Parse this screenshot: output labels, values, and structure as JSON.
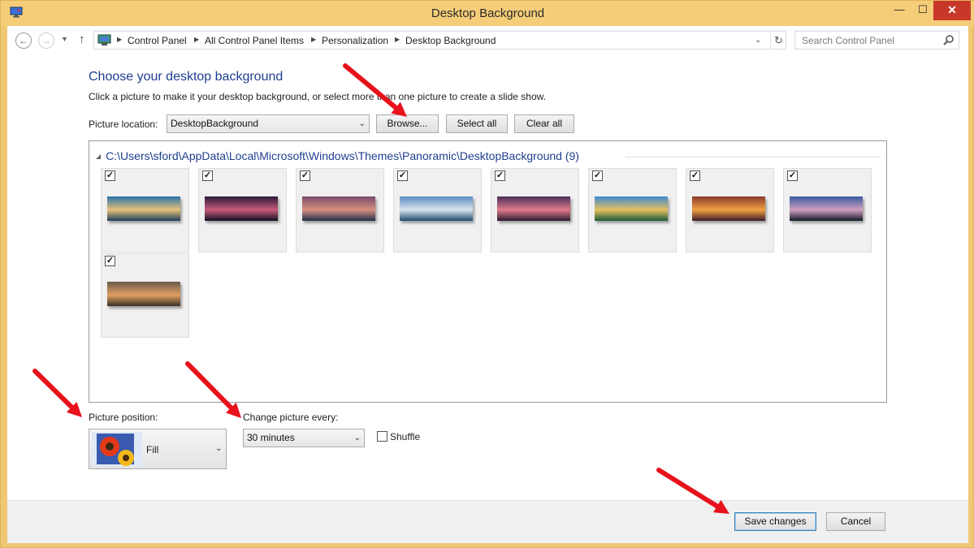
{
  "window": {
    "title": "Desktop Background",
    "min_glyph": "—",
    "max_glyph": "☐",
    "close_glyph": "✕"
  },
  "nav": {
    "back_glyph": "←",
    "forward_glyph": "→",
    "up_glyph": "↑",
    "breadcrumbs": [
      "Control Panel",
      "All Control Panel Items",
      "Personalization",
      "Desktop Background"
    ],
    "search_placeholder": "Search Control Panel"
  },
  "main": {
    "heading": "Choose your desktop background",
    "subtext": "Click a picture to make it your desktop background, or select more than one picture to create a slide show.",
    "picture_location_label": "Picture location:",
    "picture_location_value": "DesktopBackground",
    "browse_label": "Browse...",
    "select_all_label": "Select all",
    "clear_all_label": "Clear all",
    "group_path": "C:\\Users\\sford\\AppData\\Local\\Microsoft\\Windows\\Themes\\Panoramic\\DesktopBackground (9)",
    "thumbnails": [
      {
        "checked": true,
        "colors": [
          "#2a6fa8",
          "#e8c27a",
          "#1c3d5a"
        ]
      },
      {
        "checked": true,
        "colors": [
          "#2b1a3a",
          "#c85a7a",
          "#111122"
        ]
      },
      {
        "checked": true,
        "colors": [
          "#7a4a6a",
          "#d89080",
          "#1d2f4a"
        ]
      },
      {
        "checked": true,
        "colors": [
          "#5a8cc0",
          "#d8e4ee",
          "#1f4a6e"
        ]
      },
      {
        "checked": true,
        "colors": [
          "#4a2e5a",
          "#e07a8a",
          "#2a1a30"
        ]
      },
      {
        "checked": true,
        "colors": [
          "#3a8ad0",
          "#e6c060",
          "#1a5a3a"
        ]
      },
      {
        "checked": true,
        "colors": [
          "#8a3a2a",
          "#f0a040",
          "#3a1a2a"
        ]
      },
      {
        "checked": true,
        "colors": [
          "#3a5aa0",
          "#d0a0c0",
          "#101828"
        ]
      },
      {
        "checked": true,
        "colors": [
          "#6a5a4a",
          "#e0a060",
          "#3a3028"
        ]
      }
    ],
    "picture_position_label": "Picture position:",
    "picture_position_value": "Fill",
    "change_picture_label": "Change picture every:",
    "change_picture_value": "30 minutes",
    "shuffle_label": "Shuffle",
    "shuffle_checked": false
  },
  "footer": {
    "save_label": "Save changes",
    "cancel_label": "Cancel"
  },
  "annotation_color": "#e8121b"
}
